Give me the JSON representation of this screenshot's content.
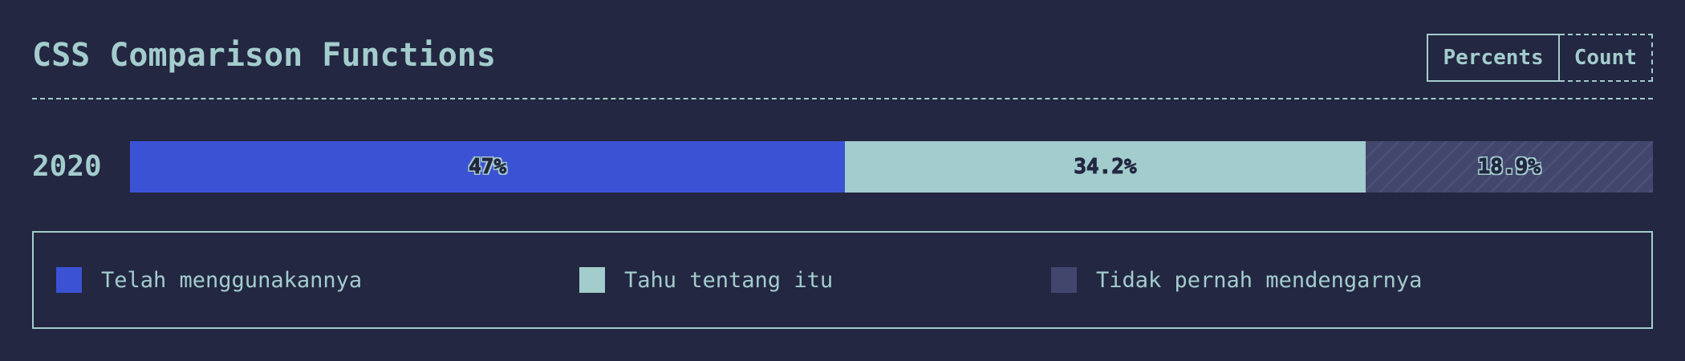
{
  "title": "CSS Comparison Functions",
  "toggle": {
    "percents_label": "Percents",
    "count_label": "Count",
    "active": "percents"
  },
  "chart_data": {
    "type": "bar",
    "orientation": "horizontal",
    "stacked": true,
    "normalized": true,
    "categories": [
      "2020"
    ],
    "series": [
      {
        "name": "Telah menggunakannya",
        "values": [
          47
        ],
        "label": "47%",
        "color": "#3c52d4"
      },
      {
        "name": "Tahu tentang itu",
        "values": [
          34.2
        ],
        "label": "34.2%",
        "color": "#a3cccd"
      },
      {
        "name": "Tidak pernah mendengarnya",
        "values": [
          18.9
        ],
        "label": "18.9%",
        "color": "#42466d"
      }
    ],
    "legend_position": "bottom"
  }
}
